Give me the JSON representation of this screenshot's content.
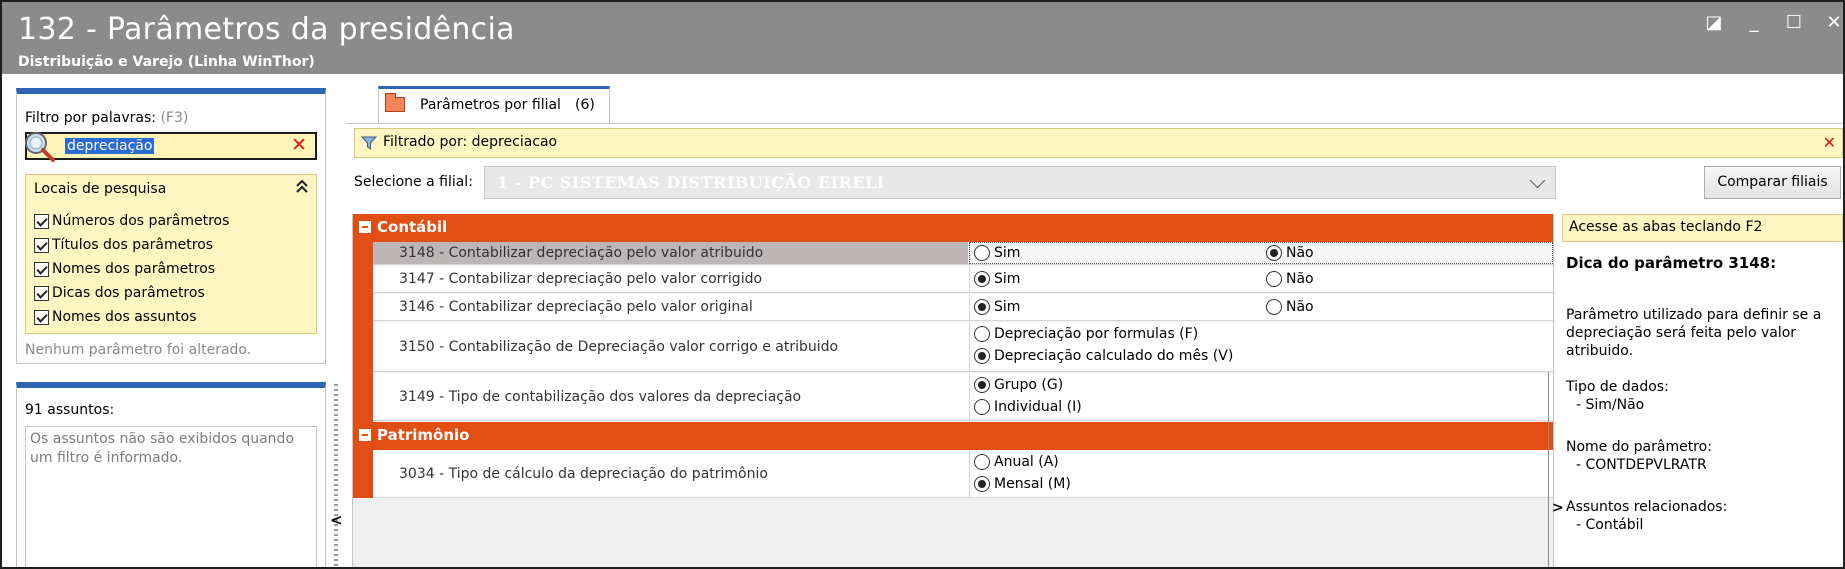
{
  "window": {
    "title": "132 - Parâmetros da presidência",
    "subtitle": "Distribuição e Varejo (Linha WinThor)",
    "controls": {
      "restore": "◪",
      "minimize": "_",
      "maximize": "☐",
      "close": "✕"
    }
  },
  "filter": {
    "label": "Filtro por palavras:",
    "shortcut": "(F3)",
    "search_value": "depreciação",
    "clear_icon": "✕",
    "places_header": "Locais de pesquisa",
    "places_collapse_icon": "chevrons-up-icon",
    "places_collapse_glyph": "≈",
    "places": [
      {
        "label": "Números dos parâmetros",
        "checked": true
      },
      {
        "label": "Títulos dos parâmetros",
        "checked": true
      },
      {
        "label": "Nomes dos parâmetros",
        "checked": true
      },
      {
        "label": "Dicas dos parâmetros",
        "checked": true
      },
      {
        "label": "Nomes dos assuntos",
        "checked": true
      }
    ],
    "status": "Nenhum parâmetro foi alterado."
  },
  "subjects": {
    "count_label": "91 assuntos:",
    "info": "Os assuntos não são exibidos quando um filtro é informado."
  },
  "splitter": {
    "arrow": "<"
  },
  "tab": {
    "label": "Parâmetros por filial",
    "count": "(6)"
  },
  "banner": {
    "text": "Filtrado por: depreciacao",
    "close": "✕"
  },
  "branch": {
    "label": "Selecione a filial:",
    "value": "1 - PC SISTEMAS DISTRIBUIÇÃO  EIRELI",
    "compare_button": "Comparar filiais"
  },
  "groups": [
    {
      "title": "Contábil",
      "rows": [
        {
          "label": "3148 - Contabilizar depreciação pelo valor atribuido",
          "selected": true,
          "layout": "inline",
          "options": [
            {
              "label": "Sim",
              "checked": false
            },
            {
              "label": "Não",
              "checked": true
            }
          ]
        },
        {
          "label": "3147 - Contabilizar depreciação pelo valor corrigido",
          "selected": false,
          "layout": "inline",
          "options": [
            {
              "label": "Sim",
              "checked": true
            },
            {
              "label": "Não",
              "checked": false
            }
          ]
        },
        {
          "label": "3146 - Contabilizar depreciação pelo valor original",
          "selected": false,
          "layout": "inline",
          "options": [
            {
              "label": "Sim",
              "checked": true
            },
            {
              "label": "Não",
              "checked": false
            }
          ]
        },
        {
          "label": "3150 - Contabilização de Depreciação valor corrigo e atribuido",
          "selected": false,
          "layout": "stacked",
          "options": [
            {
              "label": "Depreciação por formulas (F)",
              "checked": false
            },
            {
              "label": "Depreciação calculado do mês (V)",
              "checked": true
            }
          ]
        },
        {
          "label": "3149 - Tipo de contabilização dos valores da depreciação",
          "selected": false,
          "layout": "stacked",
          "options": [
            {
              "label": "Grupo (G)",
              "checked": true
            },
            {
              "label": "Individual (I)",
              "checked": false
            }
          ]
        }
      ]
    },
    {
      "title": "Patrimônio",
      "rows": [
        {
          "label": "3034 - Tipo de cálculo da depreciação do patrimônio",
          "selected": false,
          "layout": "stacked",
          "options": [
            {
              "label": "Anual (A)",
              "checked": false
            },
            {
              "label": "Mensal (M)",
              "checked": true
            }
          ]
        }
      ]
    }
  ],
  "tip": {
    "access": "Acesse as abas teclando F2",
    "title": "Dica do parâmetro 3148:",
    "text": "Parâmetro utilizado para definir se a depreciação será feita pelo valor atribuido.",
    "data_type_label": "Tipo de dados:",
    "data_type_value": "- Sim/Não",
    "param_name_label": "Nome do parâmetro:",
    "param_name_value": "- CONTDEPVLRATR",
    "related_label": "Assuntos relacionados:",
    "related_value": "- Contábil",
    "expand_glyph": ">"
  },
  "colors": {
    "accent": "#2d63b5",
    "group_header": "#e14f14",
    "highlight": "#fff7c2",
    "title_bar": "#8b8b8b",
    "clear": "#e01414"
  }
}
